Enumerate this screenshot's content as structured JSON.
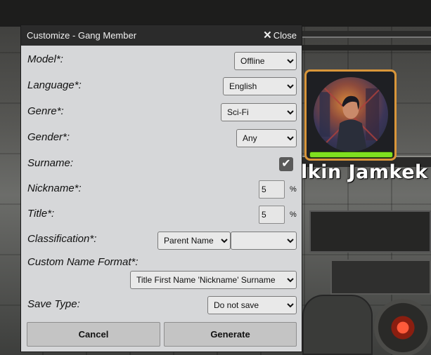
{
  "dialog": {
    "title": "Customize - Gang Member",
    "close_label": "Close"
  },
  "fields": {
    "model": {
      "label": "Model*:",
      "value": "Offline"
    },
    "language": {
      "label": "Language*:",
      "value": "English"
    },
    "genre": {
      "label": "Genre*:",
      "value": "Sci-Fi"
    },
    "gender": {
      "label": "Gender*:",
      "value": "Any"
    },
    "surname": {
      "label": "Surname:",
      "checked": true
    },
    "nickname": {
      "label": "Nickname*:",
      "value": "5",
      "unit": "%"
    },
    "title": {
      "label": "Title*:",
      "value": "5",
      "unit": "%"
    },
    "classification": {
      "label": "Classification*:",
      "value": "Parent Name",
      "value2": ""
    },
    "custom_name_format": {
      "label": "Custom Name Format*:",
      "value": "Title First Name 'Nickname' Surname"
    },
    "save_type": {
      "label": "Save Type:",
      "value": "Do not save"
    }
  },
  "buttons": {
    "cancel": "Cancel",
    "generate": "Generate"
  },
  "character": {
    "name": "lkin Jamkek",
    "health_fraction": 1.0
  },
  "colors": {
    "titlebar": "#2b2b2b",
    "dialog_bg": "#d6d7d9",
    "card_border": "#d9963a",
    "health": "#7fe01f"
  }
}
